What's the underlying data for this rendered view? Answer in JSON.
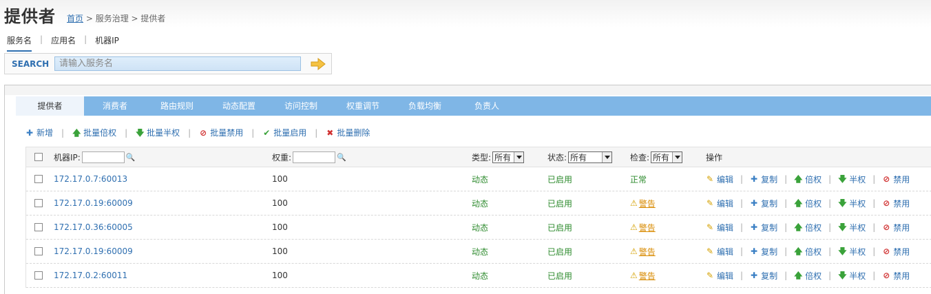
{
  "header": {
    "title": "提供者",
    "breadcrumb": {
      "home": "首页",
      "rest": " > 服务治理 > 提供者"
    }
  },
  "search": {
    "tabs": [
      "服务名",
      "应用名",
      "机器IP"
    ],
    "label": "SEARCH",
    "placeholder": "请输入服务名"
  },
  "tabs": [
    {
      "label": "提供者",
      "active": true
    },
    {
      "label": "消费者"
    },
    {
      "label": "路由规则"
    },
    {
      "label": "动态配置"
    },
    {
      "label": "访问控制"
    },
    {
      "label": "权重调节"
    },
    {
      "label": "负载均衡"
    },
    {
      "label": "负责人"
    }
  ],
  "actions": [
    {
      "label": "新增",
      "icon": "plus-icon",
      "color": "#2f6fb0"
    },
    {
      "label": "批量倍权",
      "icon": "arrow-up-icon",
      "color": "#3aa23a"
    },
    {
      "label": "批量半权",
      "icon": "arrow-down-icon",
      "color": "#3aa23a"
    },
    {
      "label": "批量禁用",
      "icon": "forbidden-icon",
      "color": "#d03030"
    },
    {
      "label": "批量启用",
      "icon": "check-icon",
      "color": "#3aa23a"
    },
    {
      "label": "批量删除",
      "icon": "x-icon",
      "color": "#d03030"
    }
  ],
  "table": {
    "header": {
      "ip": "机器IP:",
      "weight": "权重:",
      "type": "类型:",
      "type_value": "所有",
      "status": "状态:",
      "status_value": "所有",
      "check": "检查:",
      "check_value": "所有",
      "ops": "操作"
    },
    "ops": [
      "编辑",
      "复制",
      "倍权",
      "半权",
      "禁用"
    ],
    "rows": [
      {
        "ip": "172.17.0.7:60013",
        "weight": "100",
        "type": "动态",
        "status": "已启用",
        "check": "正常",
        "warn": false
      },
      {
        "ip": "172.17.0.19:60009",
        "weight": "100",
        "type": "动态",
        "status": "已启用",
        "check": "警告",
        "warn": true
      },
      {
        "ip": "172.17.0.36:60005",
        "weight": "100",
        "type": "动态",
        "status": "已启用",
        "check": "警告",
        "warn": true
      },
      {
        "ip": "172.17.0.19:60009",
        "weight": "100",
        "type": "动态",
        "status": "已启用",
        "check": "警告",
        "warn": true
      },
      {
        "ip": "172.17.0.2:60011",
        "weight": "100",
        "type": "动态",
        "status": "已启用",
        "check": "警告",
        "warn": true
      }
    ]
  },
  "colors": {
    "accent": "#2f6fb0",
    "tabbar": "#7fb6e6",
    "ok": "#2e8b2e",
    "warn": "#d88a00"
  }
}
